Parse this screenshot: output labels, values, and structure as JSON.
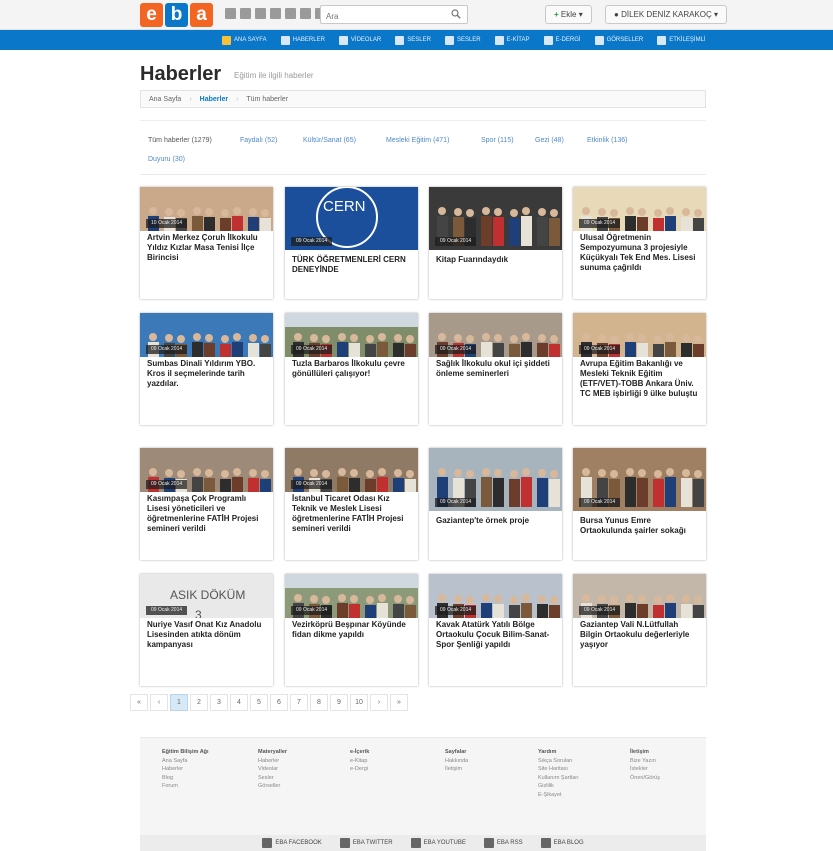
{
  "header": {
    "logo": [
      "e",
      "b",
      "a"
    ],
    "search_placeholder": "Ara",
    "add_button": "Ekle",
    "user_button": "DİLEK DENİZ KARAKOÇ",
    "chevron": "▾"
  },
  "nav": {
    "items": [
      "ANA SAYFA",
      "HABERLER",
      "VİDEOLAR",
      "SESLER",
      "SESLER",
      "E-KİTAP",
      "E-DERGİ",
      "GÖRSELLER",
      "ETKİLEŞİMLİ"
    ]
  },
  "page": {
    "title": "Haberler",
    "subtitle": "Eğitim ile ilgili haberler",
    "breadcrumb": [
      "Ana Sayfa",
      "Haberler",
      "Tüm haberler"
    ]
  },
  "tabs": [
    "Tüm haberler (1279)",
    "Faydalı (52)",
    "Kültür/Sanat (65)",
    "Mesleki Eğitim (471)",
    "Spor (115)",
    "Gezi (48)",
    "Etkinlik (136)",
    "Duyuru (30)"
  ],
  "cards": [
    {
      "date": "10 Ocak 2014",
      "title": "Artvin Merkez Çoruh İlkokulu Yıldız Kızlar Masa Tenisi İlçe Birincisi",
      "scene": "gym"
    },
    {
      "date": "09 Ocak 2014",
      "title": "TÜRK ÖĞRETMENLERİ CERN DENEYİNDE",
      "scene": "cern"
    },
    {
      "date": "09 Ocak 2014",
      "title": "Kitap Fuarındaydık",
      "scene": "crowd"
    },
    {
      "date": "09 Ocak 2014",
      "title": "Ulusal Öğretmenin Sempozyumuna 3 projesiyle Küçükyalı Tek End Mes. Lisesi sunuma çağrıldı",
      "scene": "room"
    },
    {
      "date": "09 Ocak 2014",
      "title": "Sumbas Dinali Yıldırım YBO. Kros il seçmelerinde tarih yazdılar.",
      "scene": "team"
    },
    {
      "date": "09 Ocak 2014",
      "title": "Tuzla Barbaros İlkokulu çevre gönüllüleri çalışıyor!",
      "scene": "outdoor"
    },
    {
      "date": "09 Ocak 2014",
      "title": "Sağlık İlkokulu okul içi şiddeti önleme seminerleri",
      "scene": "students"
    },
    {
      "date": "09 Ocak 2014",
      "title": "Avrupa Eğitim Bakanlığı ve Mesleki Teknik Eğitim (ETF/VET)-TOBB Ankara Üniv. TC MEB işbirliği 9 ülke buluştu",
      "scene": "meeting"
    },
    {
      "date": "09 Ocak 2014",
      "title": "Kasımpaşa Çok Programlı Lisesi yöneticileri ve öğretmenlerine FATİH Projesi semineri verildi",
      "scene": "classroom"
    },
    {
      "date": "09 Ocak 2014",
      "title": "İstanbul Ticaret Odası Kız Teknik ve Meslek Lisesi öğretmenlerine FATİH Projesi semineri verildi",
      "scene": "classroom2"
    },
    {
      "date": "09 Ocak 2014",
      "title": "Gaziantep'te örnek proje",
      "scene": "lab"
    },
    {
      "date": "09 Ocak 2014",
      "title": "Bursa Yunus Emre Ortaokulunda şairler sokağı",
      "scene": "hall"
    },
    {
      "date": "09 Ocak 2014",
      "title": "Nuriye Vasıf Onat Kız Anadolu Lisesinden atıkta dönüm kampanyası",
      "scene": "board"
    },
    {
      "date": "09 Ocak 2014",
      "title": "Vezirköprü Beşpınar Köyünde fidan dikme yapıldı",
      "scene": "field"
    },
    {
      "date": "09 Ocak 2014",
      "title": "Kavak Atatürk Yatılı Bölge Ortaokulu Çocuk Bilim-Sanat-Spor Şenliği yapıldı",
      "scene": "science"
    },
    {
      "date": "09 Ocak 2014",
      "title": "Gaziantep Vali N.Lütfullah Bilgin Ortaokulu değerleriyle yaşıyor",
      "scene": "care"
    }
  ],
  "pager": [
    "«",
    "‹",
    "1",
    "2",
    "3",
    "4",
    "5",
    "6",
    "7",
    "8",
    "9",
    "10",
    "›",
    "»"
  ],
  "footer": {
    "columns": [
      {
        "head": "Eğitim Bilişim Ağı",
        "links": [
          "Ana Sayfa",
          "Haberler",
          "Blog",
          "Forum"
        ]
      },
      {
        "head": "Materyaller",
        "links": [
          "Haberler",
          "Videolar",
          "Sesler",
          "Görseller"
        ]
      },
      {
        "head": "e-İçerik",
        "links": [
          "e-Kitap",
          "e-Dergi"
        ]
      },
      {
        "head": "Sayfalar",
        "links": [
          "Hakkında",
          "İletişim"
        ]
      },
      {
        "head": "Yardım",
        "links": [
          "Sıkça Sorulan",
          "Site Haritası",
          "Kullanım Şartları",
          "Gizlilik",
          "E-Şikayet"
        ]
      },
      {
        "head": "İletişim",
        "links": [
          "Bize Yazın",
          "İstekler",
          "Öneri/Görüş"
        ]
      }
    ],
    "social": [
      "EBA FACEBOOK",
      "EBA TWITTER",
      "EBA YOUTUBE",
      "EBA RSS",
      "EBA BLOG"
    ]
  }
}
